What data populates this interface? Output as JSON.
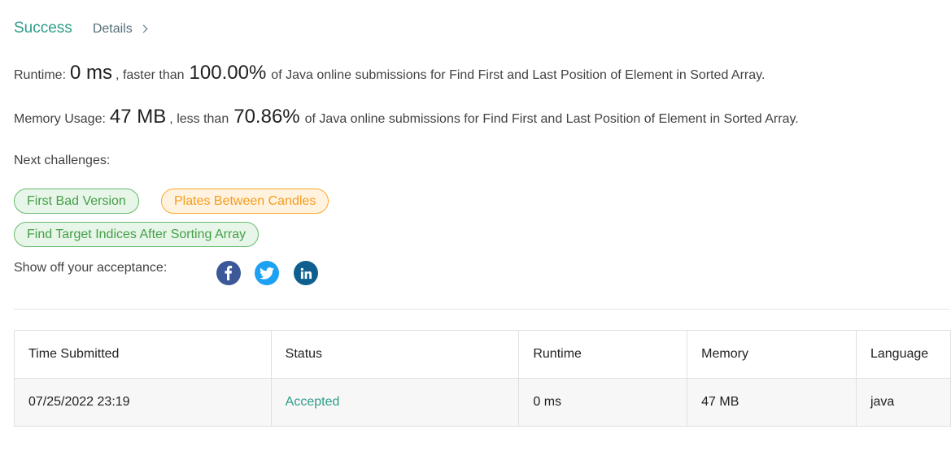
{
  "header": {
    "status": "Success",
    "details_label": "Details"
  },
  "runtime": {
    "label": "Runtime:",
    "value": "0 ms",
    "middle": ", faster than",
    "percent": "100.00%",
    "suffix": "of Java online submissions for Find First and Last Position of Element in Sorted Array."
  },
  "memory": {
    "label": "Memory Usage:",
    "value": "47 MB",
    "middle": ", less than",
    "percent": "70.86%",
    "suffix": "of Java online submissions for Find First and Last Position of Element in Sorted Array."
  },
  "next": {
    "label": "Next challenges:",
    "challenges": [
      {
        "label": "First Bad Version",
        "difficulty_color": "green"
      },
      {
        "label": "Plates Between Candles",
        "difficulty_color": "orange"
      },
      {
        "label": "Find Target Indices After Sorting Array",
        "difficulty_color": "green"
      }
    ]
  },
  "share": {
    "label": "Show off your acceptance:",
    "icons": [
      {
        "name": "facebook-icon",
        "glyph": "f",
        "color": "#3b5998"
      },
      {
        "name": "twitter-icon",
        "glyph": "t",
        "color": "#1da1f2"
      },
      {
        "name": "linkedin-icon",
        "glyph": "in",
        "color": "#0077b5"
      }
    ]
  },
  "table": {
    "headers": [
      "Time Submitted",
      "Status",
      "Runtime",
      "Memory",
      "Language"
    ],
    "rows": [
      [
        "07/25/2022 23:19",
        "Accepted",
        "0 ms",
        "47 MB",
        "java"
      ]
    ]
  }
}
